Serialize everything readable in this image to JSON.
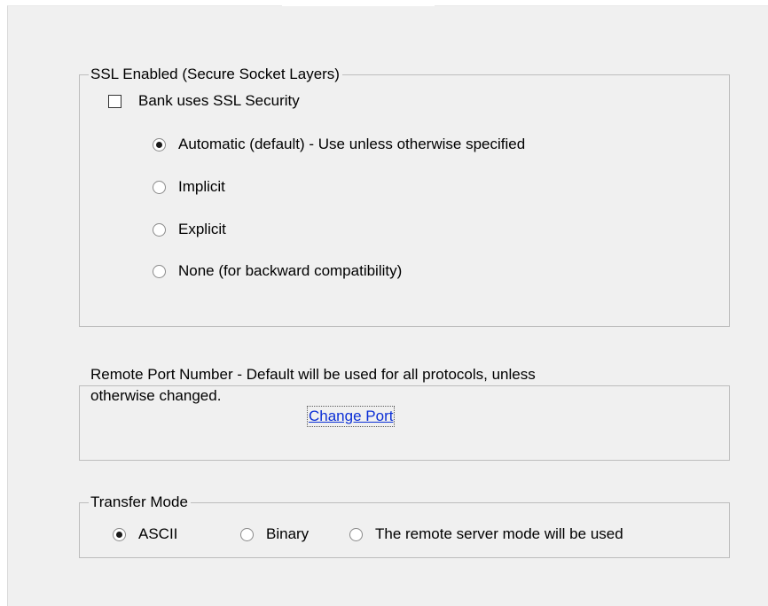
{
  "ssl_group": {
    "legend": "SSL Enabled (Secure Socket Layers)",
    "checkbox_label": "Bank uses SSL Security",
    "checkbox_checked": false,
    "options": [
      {
        "label": "Automatic (default) - Use unless otherwise specified",
        "selected": true
      },
      {
        "label": "Implicit",
        "selected": false
      },
      {
        "label": "Explicit",
        "selected": false
      },
      {
        "label": "None (for backward compatibility)",
        "selected": false
      }
    ]
  },
  "port_group": {
    "legend_line1": "Remote Port Number - Default will be used for all protocols, unless",
    "legend_line2": "otherwise changed.",
    "link_label": "Change Port"
  },
  "transfer_group": {
    "legend": "Transfer Mode",
    "options": [
      {
        "label": "ASCII",
        "selected": true
      },
      {
        "label": "Binary",
        "selected": false
      },
      {
        "label": "The remote server mode will be used",
        "selected": false
      }
    ]
  }
}
